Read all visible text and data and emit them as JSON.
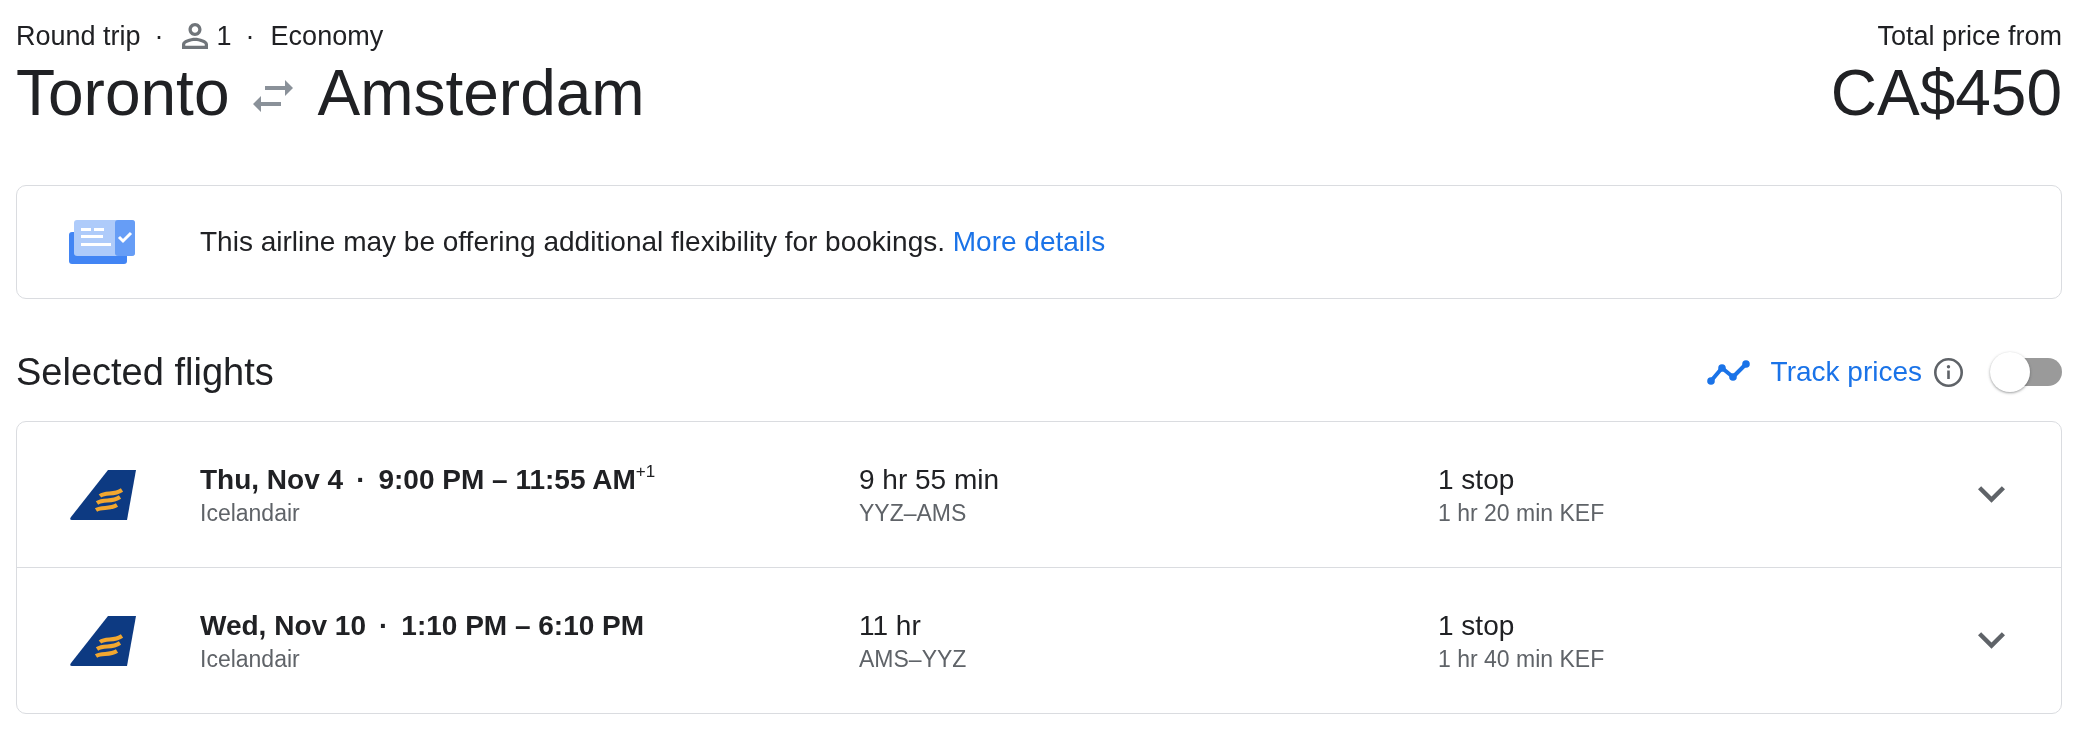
{
  "trip": {
    "trip_type": "Round trip",
    "separator_1": "·",
    "passengers": "1",
    "separator_2": "·",
    "cabin": "Economy",
    "origin": "Toronto",
    "destination": "Amsterdam"
  },
  "price": {
    "label": "Total price from",
    "amount": "CA$450"
  },
  "notice": {
    "text": "This airline may be offering additional flexibility for bookings.",
    "link": "More details"
  },
  "selected_flights": {
    "title": "Selected flights",
    "track_prices": {
      "label": "Track prices",
      "on": false
    }
  },
  "flights": [
    {
      "date": "Thu, Nov 4",
      "separator": "·",
      "times": "9:00 PM – 11:55 AM$^{+1}$",
      "airline": "Icelandair",
      "duration": "9 hr 55 min",
      "route": "YYZ–AMS",
      "stops": "1 stop",
      "layover": "1 hr 20 min KEF",
      "expanded": false
    },
    {
      "date": "Wed, Nov 10",
      "separator": "·",
      "times": "1:10 PM – 6:10 PM",
      "airline": "Icelandair",
      "duration": "11 hr",
      "route": "AMS–YYZ",
      "stops": "1 stop",
      "layover": "1 hr 40 min KEF",
      "expanded": false
    }
  ]
}
